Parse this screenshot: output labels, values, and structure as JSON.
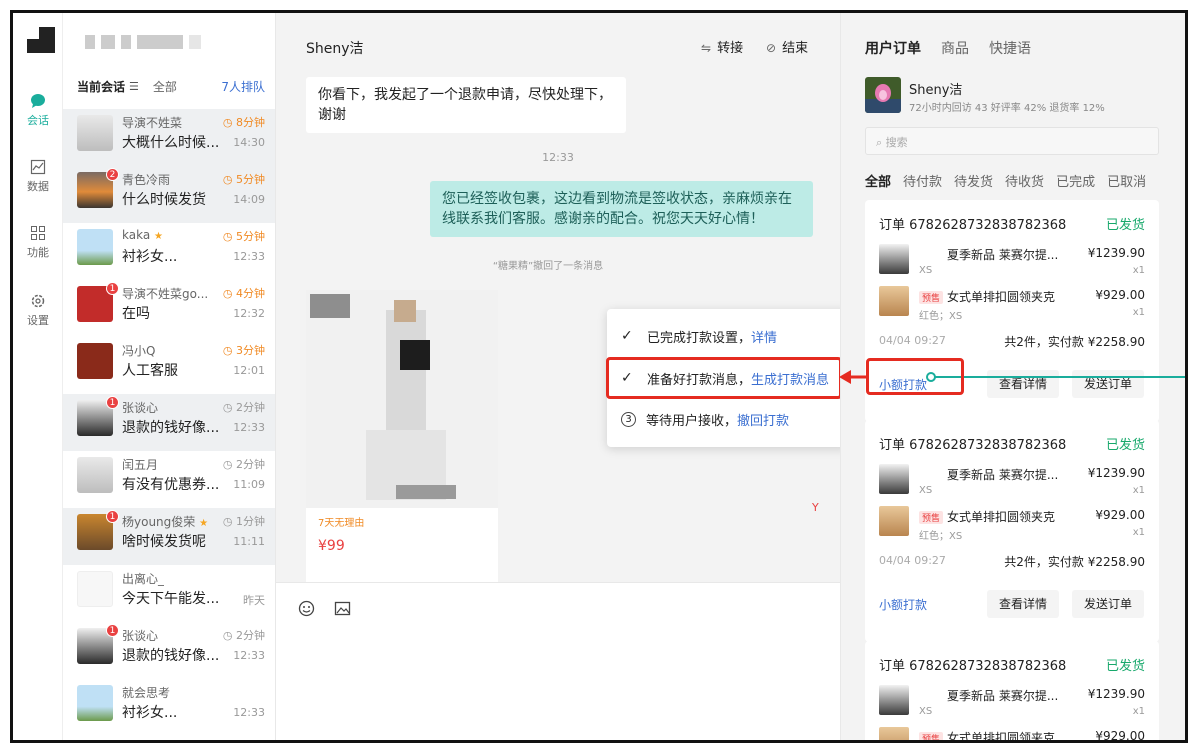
{
  "nav": {
    "items": [
      {
        "label": "会话",
        "icon": "chat-bubble-icon",
        "active": true
      },
      {
        "label": "数据",
        "icon": "chart-icon",
        "active": false
      },
      {
        "label": "功能",
        "icon": "grid-icon",
        "active": false
      },
      {
        "label": "设置",
        "icon": "gear-icon",
        "active": false
      }
    ]
  },
  "conversations": {
    "current_label": "当前会话",
    "filter_icon": "filter-icon",
    "all_label": "全部",
    "queue_label": "7人排队",
    "items": [
      {
        "name": "导演不姓菜",
        "wait": "8分钟",
        "message": "大概什么时候...",
        "time": "14:30",
        "badge": ""
      },
      {
        "name": "青色冷雨",
        "wait": "5分钟",
        "message": "什么时候发货",
        "time": "14:09",
        "badge": "2"
      },
      {
        "name": "kaka",
        "star": "★",
        "wait": "5分钟",
        "message": "衬衫女...",
        "time": "12:33",
        "badge": ""
      },
      {
        "name": "导演不姓菜go...",
        "wait": "4分钟",
        "message": "在吗",
        "time": "12:32",
        "badge": "1"
      },
      {
        "name": "冯小Q",
        "wait": "3分钟",
        "message": "人工客服",
        "time": "12:01",
        "badge": ""
      },
      {
        "name": "张谈心",
        "wait": "2分钟",
        "message": "退款的钱好像...",
        "time": "12:33",
        "badge": "1"
      },
      {
        "name": "闰五月",
        "wait": "2分钟",
        "message": "有没有优惠券...",
        "time": "11:09",
        "badge": ""
      },
      {
        "name": "杨young俊荣",
        "star": "★",
        "wait": "1分钟",
        "message": "啥时候发货呢",
        "time": "11:11",
        "badge": "1"
      },
      {
        "name": "出离心_",
        "wait": "",
        "message": "今天下午能发...",
        "time": "昨天",
        "badge": ""
      },
      {
        "name": "张谈心",
        "wait": "2分钟",
        "message": "退款的钱好像...",
        "time": "12:33",
        "badge": "1"
      },
      {
        "name": "就会思考",
        "wait": "",
        "message": "衬衫女...",
        "time": "12:33",
        "badge": ""
      }
    ]
  },
  "chat": {
    "title": "Sheny洁",
    "transfer_label": "转接",
    "end_label": "结束",
    "incoming_message": "你看下，我发起了一个退款申请，尽快处理下，谢谢",
    "time_separator": "12:33",
    "outgoing_message": "您已经签收包裹，这边看到物流是签收状态，亲麻烦亲在线联系我们客服。感谢亲的配合。祝您天天好心情！",
    "recall_notice": "“糖果精”撤回了一条消息",
    "product_tag": "7天无理由",
    "product_price": "¥99",
    "stray_mark": "Y"
  },
  "popup": {
    "step1_text": "已完成打款设置，",
    "step1_link": "详情",
    "step2_text": "准备好打款消息，",
    "step2_link": "生成打款消息",
    "step3_num": "3",
    "step3_text": "等待用户接收，",
    "step3_link": "撤回打款"
  },
  "panel": {
    "tabs": [
      "用户订单",
      "商品",
      "快捷语"
    ],
    "user_name": "Sheny洁",
    "user_stats": "72小时内回访 43    好评率 42%    退货率 12%",
    "search_placeholder": "搜索",
    "filters": [
      "全部",
      "待付款",
      "待发货",
      "待收货",
      "已完成",
      "已取消"
    ],
    "orders": [
      {
        "number": "订单 6782628732838782368",
        "status": "已发货",
        "line1_title": "夏季新品 莱赛尔提...",
        "line1_sku": "XS",
        "line1_price": "¥1239.90",
        "line1_qty": "x1",
        "line2_tag": "预售",
        "line2_title": "女式单排扣圆领夹克",
        "line2_sku": "红色；XS",
        "line2_price": "¥929.00",
        "line2_qty": "x1",
        "date": "04/04 09:27",
        "total": "共2件，实付款 ¥2258.90",
        "pay_label": "小额打款",
        "detail_label": "查看详情",
        "send_label": "发送订单"
      },
      {
        "number": "订单 6782628732838782368",
        "status": "已发货",
        "line1_title": "夏季新品 莱赛尔提...",
        "line1_sku": "XS",
        "line1_price": "¥1239.90",
        "line1_qty": "x1",
        "line2_tag": "预售",
        "line2_title": "女式单排扣圆领夹克",
        "line2_sku": "红色；XS",
        "line2_price": "¥929.00",
        "line2_qty": "x1",
        "date": "04/04 09:27",
        "total": "共2件，实付款 ¥2258.90",
        "pay_label": "小额打款",
        "detail_label": "查看详情",
        "send_label": "发送订单"
      },
      {
        "number": "订单 6782628732838782368",
        "status": "已发货",
        "line1_title": "夏季新品 莱赛尔提...",
        "line1_sku": "XS",
        "line1_price": "¥1239.90",
        "line1_qty": "x1",
        "line2_tag": "预售",
        "line2_title": "女式单排扣圆领夹克",
        "line2_price": "¥929.00"
      }
    ]
  },
  "colors": {
    "accent": "#1aad9c",
    "highlight_red": "#e52b20",
    "link_blue": "#3b6fd1",
    "status_green": "#17a86b",
    "wait_orange": "#f08a24"
  }
}
